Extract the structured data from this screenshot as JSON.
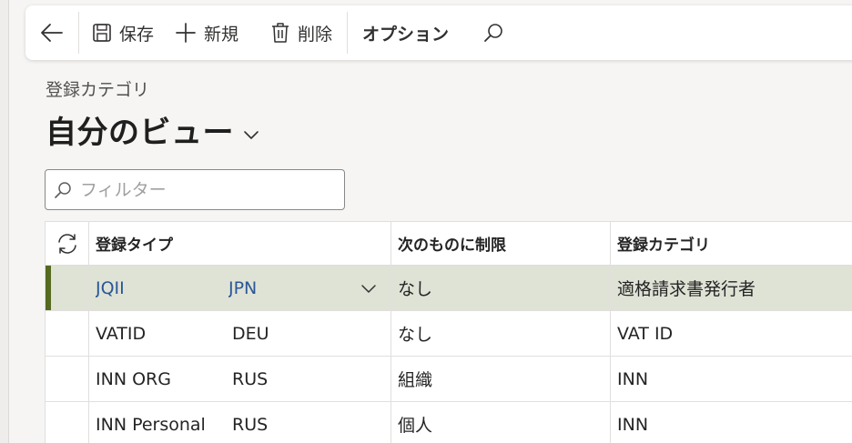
{
  "toolbar": {
    "save_label": "保存",
    "new_label": "新規",
    "delete_label": "削除",
    "options_label": "オプション"
  },
  "header": {
    "breadcrumb": "登録カテゴリ",
    "page_title": "自分のビュー"
  },
  "filter": {
    "placeholder": "フィルター",
    "value": ""
  },
  "grid": {
    "columns": {
      "registration_type": "登録タイプ",
      "restrict_to": "次のものに制限",
      "registration_category": "登録カテゴリ"
    },
    "rows": [
      {
        "type": "JQII",
        "country": "JPN",
        "restrict": "なし",
        "category": "適格請求書発行者",
        "selected": true
      },
      {
        "type": "VATID",
        "country": "DEU",
        "restrict": "なし",
        "category": "VAT ID",
        "selected": false
      },
      {
        "type": "INN ORG",
        "country": "RUS",
        "restrict": "組織",
        "category": "INN",
        "selected": false
      },
      {
        "type": "INN Personal",
        "country": "RUS",
        "restrict": "個人",
        "category": "INN",
        "selected": false
      }
    ]
  },
  "colors": {
    "accent": "#55691f",
    "selected_row": "#dfe3d6",
    "link": "#2b5797"
  }
}
